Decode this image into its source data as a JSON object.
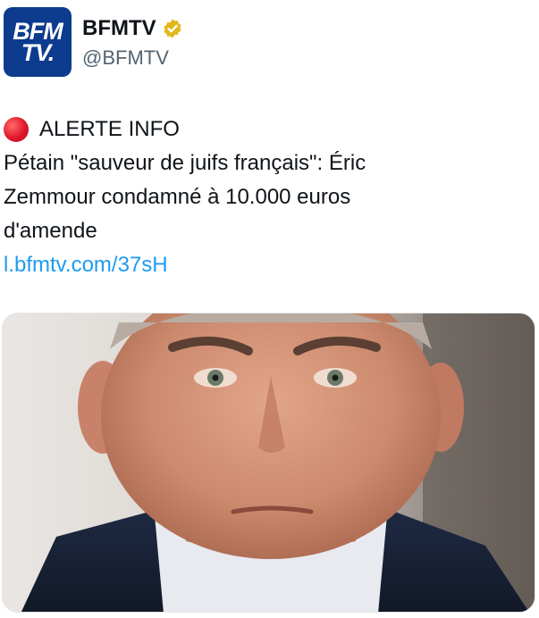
{
  "account": {
    "avatar_line1": "BFM",
    "avatar_line2": "TV.",
    "name": "BFMTV",
    "handle": "@BFMTV",
    "verified_icon": "gold-verified-badge-icon",
    "brand_color": "#0d3b8e"
  },
  "tweet": {
    "alert_icon": "red-circle-icon",
    "alert_label": "ALERTE INFO",
    "text_line1": "Pétain \"sauveur de juifs français\": Éric",
    "text_line2": "Zemmour condamné à 10.000 euros",
    "text_line3": "d'amende",
    "link": "l.bfmtv.com/37sH",
    "link_color": "#1d9bf0"
  },
  "media": {
    "type": "photo",
    "subject": "portrait-photo"
  }
}
